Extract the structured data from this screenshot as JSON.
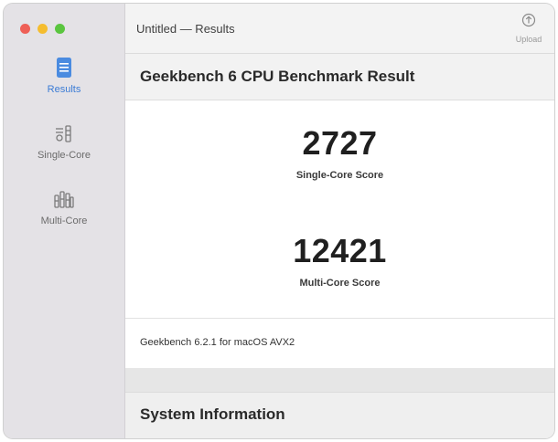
{
  "window": {
    "title": "Untitled — Results"
  },
  "toolbar": {
    "upload_label": "Upload",
    "upload_icon": "upload-icon"
  },
  "sidebar": {
    "items": [
      {
        "label": "Results",
        "icon": "results-document-icon",
        "active": true
      },
      {
        "label": "Single-Core",
        "icon": "single-core-icon",
        "active": false
      },
      {
        "label": "Multi-Core",
        "icon": "multi-core-icon",
        "active": false
      }
    ]
  },
  "result": {
    "heading": "Geekbench 6 CPU Benchmark Result",
    "single_core_score": "2727",
    "single_core_label": "Single-Core Score",
    "multi_core_score": "12421",
    "multi_core_label": "Multi-Core Score",
    "version": "Geekbench 6.2.1 for macOS AVX2"
  },
  "system_info": {
    "heading": "System Information"
  },
  "colors": {
    "accent": "#3a7bd5",
    "close": "#ee5f56",
    "minimize": "#f5bd2f",
    "zoom": "#5ac53f"
  }
}
